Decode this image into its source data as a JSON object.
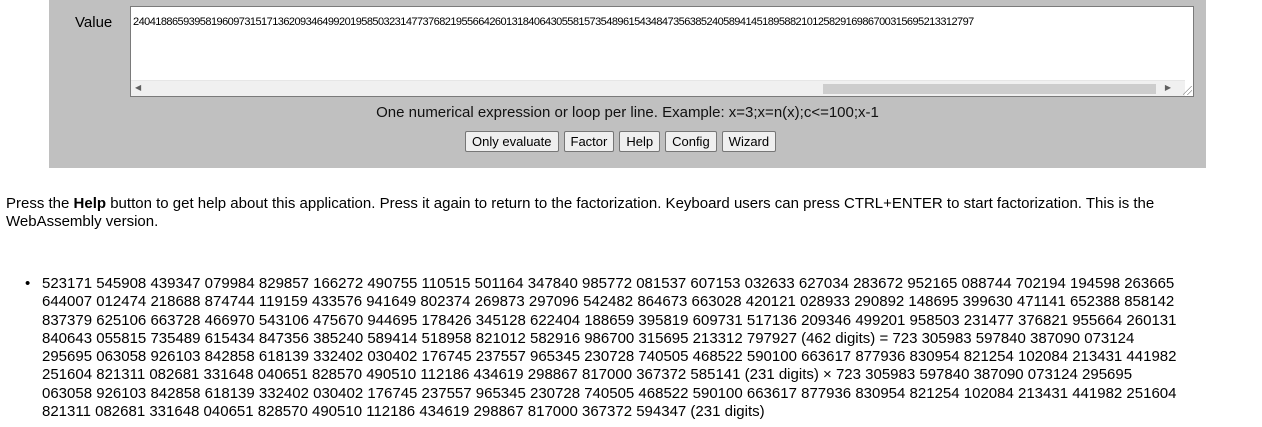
{
  "form": {
    "value_label": "Value",
    "textarea_value": "2404188659395819609731517136209346499201958503231477376821955664260131840643055815735489615434847356385240589414518958821012582916986700315695213312797",
    "hint": "One numerical expression or loop per line. Example: x=3;x=n(x);c<=100;x-1",
    "buttons": {
      "only_evaluate": "Only evaluate",
      "factor": "Factor",
      "help": "Help",
      "config": "Config",
      "wizard": "Wizard"
    }
  },
  "help_text": {
    "prefix": "Press the ",
    "bold": "Help",
    "suffix": " button to get help about this application. Press it again to return to the factorization. Keyboard users can press CTRL+ENTER to start factorization. This is the WebAssembly version."
  },
  "result": {
    "line1": "523171 545908 439347 079984 829857 166272 490755 110515 501164 347840 985772 081537 607153 032633 627034 283672 952165 088744 702194 194598 263665",
    "line2": "644007 012474 218688 874744 119159 433576 941649 802374 269873 297096 542482 864673 663028 420121 028933 290892 148695 399630 471141 652388 858142",
    "line3": "837379 625106 663728 466970 543106 475670 944695 178426 345128 622404 188659 395819 609731 517136 209346 499201 958503 231477 376821 955664 260131",
    "line4": "840643 055815 735489 615434 847356 385240 589414 518958 821012 582916 986700 315695 213312 797927 (462 digits) = 723 305983 597840 387090 073124",
    "line5": "295695 063058 926103 842858 618139 332402 030402 176745 237557 965345 230728 740505 468522 590100 663617 877936 830954 821254 102084 213431 441982",
    "line6": "251604 821311 082681 331648 040651 828570 490510 112186 434619 298867 817000 367372 585141 (231 digits) × 723 305983 597840 387090 073124 295695",
    "line7": "063058 926103 842858 618139 332402 030402 176745 237557 965345 230728 740505 468522 590100 663617 877936 830954 821254 102084 213431 441982 251604",
    "line8": "821311 082681 331648 040651 828570 490510 112186 434619 298867 817000 367372 594347 (231 digits)"
  }
}
